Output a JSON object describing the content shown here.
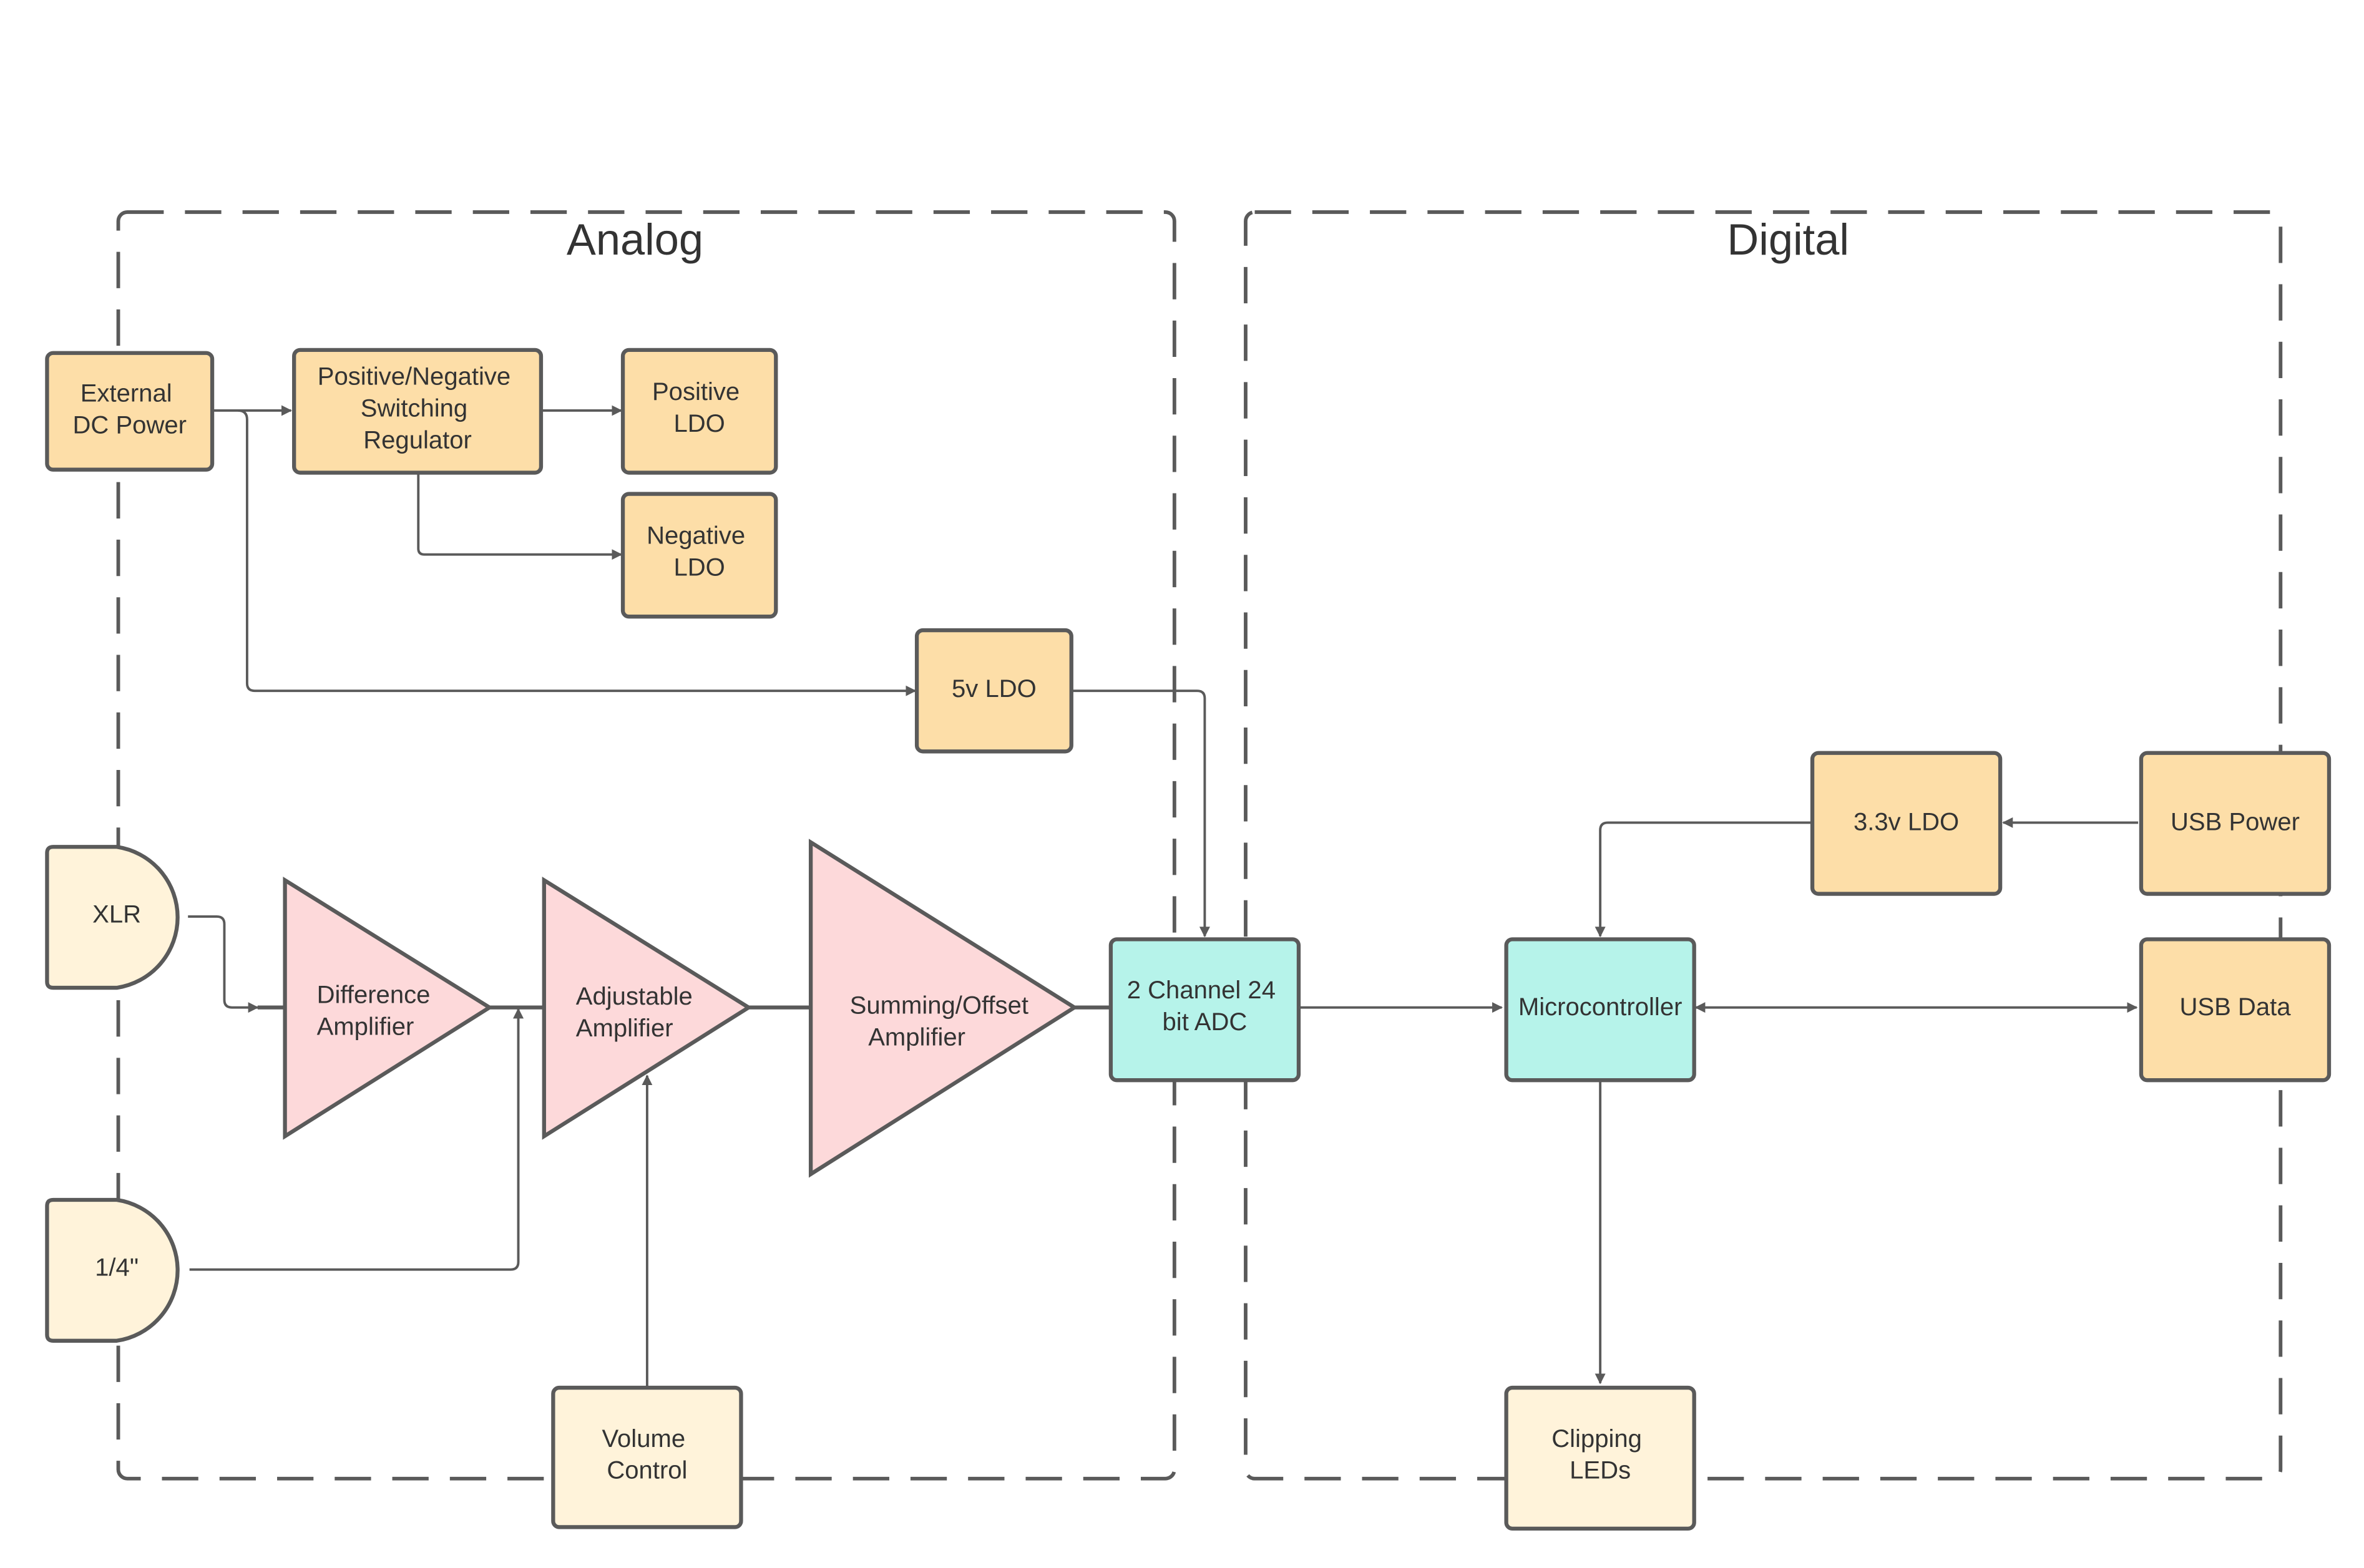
{
  "colors": {
    "power": "#fddea8",
    "connector": "#fff3da",
    "amplifier": "#fdd9da",
    "digital": "#b6f3ea",
    "line": "#5a5a5a",
    "text": "#333333"
  },
  "zones": {
    "analog": {
      "title": "Analog"
    },
    "digital": {
      "title": "Digital"
    }
  },
  "nodes": {
    "ext_dc": {
      "lines": [
        "External",
        "DC Power"
      ]
    },
    "pn_reg": {
      "lines": [
        "Positive/Negative",
        "Switching",
        "Regulator"
      ]
    },
    "pos_ldo": {
      "lines": [
        "Positive",
        "LDO"
      ]
    },
    "neg_ldo": {
      "lines": [
        "Negative",
        "LDO"
      ]
    },
    "ldo_5v": {
      "lines": [
        "5v LDO"
      ]
    },
    "xlr": {
      "lines": [
        "XLR"
      ]
    },
    "quarter": {
      "lines": [
        "1/4\""
      ]
    },
    "diff_amp": {
      "lines": [
        "Difference",
        "Amplifier"
      ]
    },
    "adj_amp": {
      "lines": [
        "Adjustable",
        "Amplifier"
      ]
    },
    "sum_amp": {
      "lines": [
        "Summing/Offset",
        "Amplifier"
      ]
    },
    "volume": {
      "lines": [
        "Volume",
        "Control"
      ]
    },
    "adc": {
      "lines": [
        "2 Channel 24",
        "bit ADC"
      ]
    },
    "mcu": {
      "lines": [
        "Microcontroller"
      ]
    },
    "ldo_33": {
      "lines": [
        "3.3v LDO"
      ]
    },
    "usb_power": {
      "lines": [
        "USB Power"
      ]
    },
    "usb_data": {
      "lines": [
        "USB Data"
      ]
    },
    "clip_leds": {
      "lines": [
        "Clipping",
        "LEDs"
      ]
    }
  },
  "edges": [
    {
      "from": "External DC Power",
      "to": "Positive/Negative Switching Regulator"
    },
    {
      "from": "Positive/Negative Switching Regulator",
      "to": "Positive LDO"
    },
    {
      "from": "Positive/Negative Switching Regulator",
      "to": "Negative LDO"
    },
    {
      "from": "External DC Power",
      "to": "5v LDO"
    },
    {
      "from": "5v LDO",
      "to": "2 Channel 24 bit ADC"
    },
    {
      "from": "XLR",
      "to": "Difference Amplifier"
    },
    {
      "from": "1/4\"",
      "to": "Adjustable Amplifier"
    },
    {
      "from": "Difference Amplifier",
      "to": "Adjustable Amplifier"
    },
    {
      "from": "Volume Control",
      "to": "Adjustable Amplifier"
    },
    {
      "from": "Adjustable Amplifier",
      "to": "Summing/Offset Amplifier"
    },
    {
      "from": "Summing/Offset Amplifier",
      "to": "2 Channel 24 bit ADC"
    },
    {
      "from": "2 Channel 24 bit ADC",
      "to": "Microcontroller"
    },
    {
      "from": "USB Power",
      "to": "3.3v LDO"
    },
    {
      "from": "3.3v LDO",
      "to": "Microcontroller"
    },
    {
      "from": "Microcontroller",
      "to": "USB Data",
      "bidirectional": true
    },
    {
      "from": "Microcontroller",
      "to": "Clipping LEDs"
    }
  ]
}
